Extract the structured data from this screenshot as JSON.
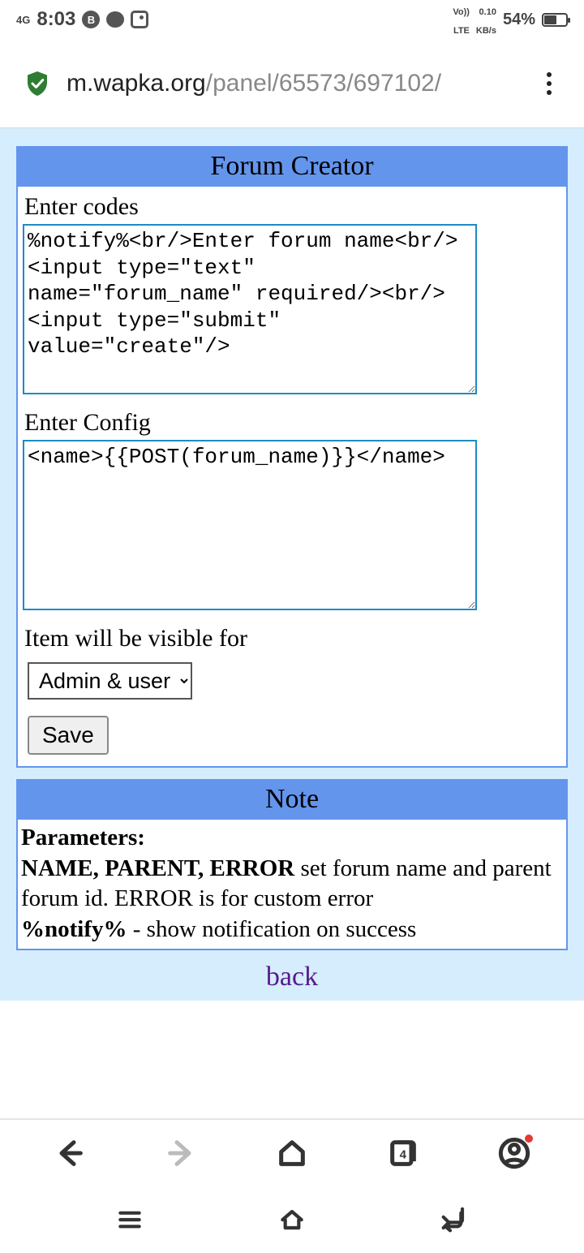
{
  "status_bar": {
    "network_type": "4G",
    "time": "8:03",
    "vol_lte": "Vo)) LTE",
    "kbs": "0.10 KB/s",
    "battery_pct": "54%"
  },
  "browser": {
    "url_host": "m.wapka.org",
    "url_path": "/panel/65573/697102/",
    "nav_tabs_count": "4"
  },
  "page": {
    "panel_title": "Forum Creator",
    "codes_label": "Enter codes",
    "codes_value": "%notify%<br/>Enter forum name<br/>\n<input type=\"text\" name=\"forum_name\" required/><br/>\n<input type=\"submit\" value=\"create\"/>",
    "config_label": "Enter Config",
    "config_value": "<name>{{POST(forum_name)}}</name>",
    "visibility_label": "Item will be visible for",
    "visibility_value": "Admin & user",
    "save_label": "Save",
    "note_title": "Note",
    "note_parameters_label": "Parameters:",
    "note_params_bold": "NAME, PARENT, ERROR",
    "note_params_text": " set forum name and parent forum id. ERROR is for custom error",
    "note_notify_bold": "%notify%",
    "note_notify_text": " - show notification on success",
    "back_label": "back"
  }
}
